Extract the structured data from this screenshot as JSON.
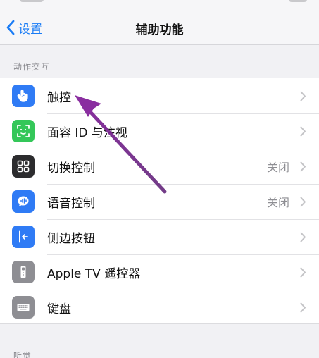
{
  "nav": {
    "back_label": "设置",
    "title": "辅助功能"
  },
  "section1": {
    "header": "动作交互",
    "rows": [
      {
        "label": "触控",
        "value": "",
        "icon": "touch-hand-icon",
        "color": "#2f7bf5"
      },
      {
        "label": "面容 ID 与注视",
        "value": "",
        "icon": "face-id-icon",
        "color": "#34c759"
      },
      {
        "label": "切换控制",
        "value": "关闭",
        "icon": "switch-control-icon",
        "color": "#2c2c2e"
      },
      {
        "label": "语音控制",
        "value": "关闭",
        "icon": "voice-control-icon",
        "color": "#2f7bf5"
      },
      {
        "label": "侧边按钮",
        "value": "",
        "icon": "side-button-icon",
        "color": "#2f7bf5"
      },
      {
        "label": "Apple TV 遥控器",
        "value": "",
        "icon": "tv-remote-icon",
        "color": "#8e8e93"
      },
      {
        "label": "键盘",
        "value": "",
        "icon": "keyboard-icon",
        "color": "#8e8e93"
      }
    ]
  },
  "section2": {
    "header": "听觉"
  },
  "annotation": {
    "color": "#7b2a8f"
  }
}
